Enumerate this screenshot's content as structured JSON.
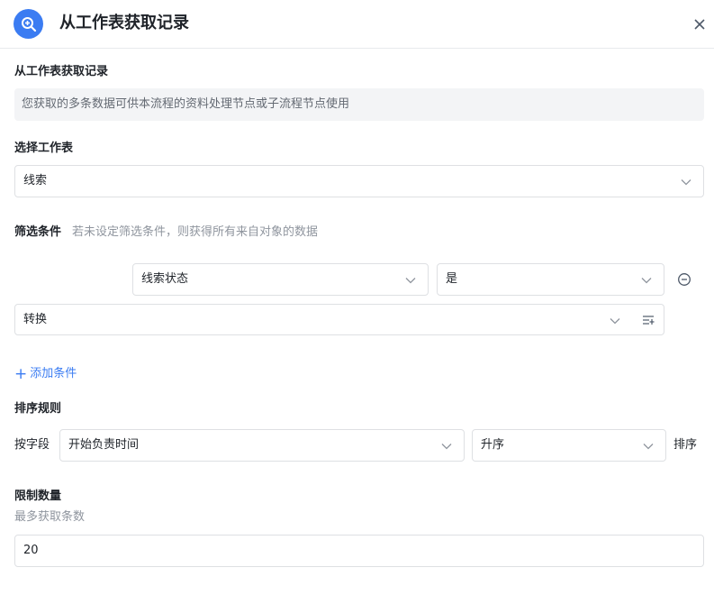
{
  "header": {
    "title": "从工作表获取记录",
    "icons": {
      "logo": "zoom-in-icon",
      "close": "close-icon"
    }
  },
  "section_title": "从工作表获取记录",
  "description": "您获取的多条数据可供本流程的资料处理节点或子流程节点使用",
  "worksheet": {
    "label": "选择工作表",
    "value": "线索"
  },
  "filter": {
    "label": "筛选条件",
    "hint": "若未设定筛选条件，则获得所有来自对象的数据",
    "condition": {
      "field": "线索状态",
      "operator": "是",
      "value": "转换"
    },
    "add_label": "添加条件"
  },
  "sort": {
    "label": "排序规则",
    "by_field_label": "按字段",
    "field": "开始负责时间",
    "order": "升序",
    "suffix": "排序"
  },
  "limit": {
    "label": "限制数量",
    "hint": "最多获取条数",
    "value": "20"
  },
  "colors": {
    "accent": "#3b7cf2",
    "border": "#dee0e3",
    "muted": "#8f959e",
    "desc_bg": "#f3f4f6"
  }
}
